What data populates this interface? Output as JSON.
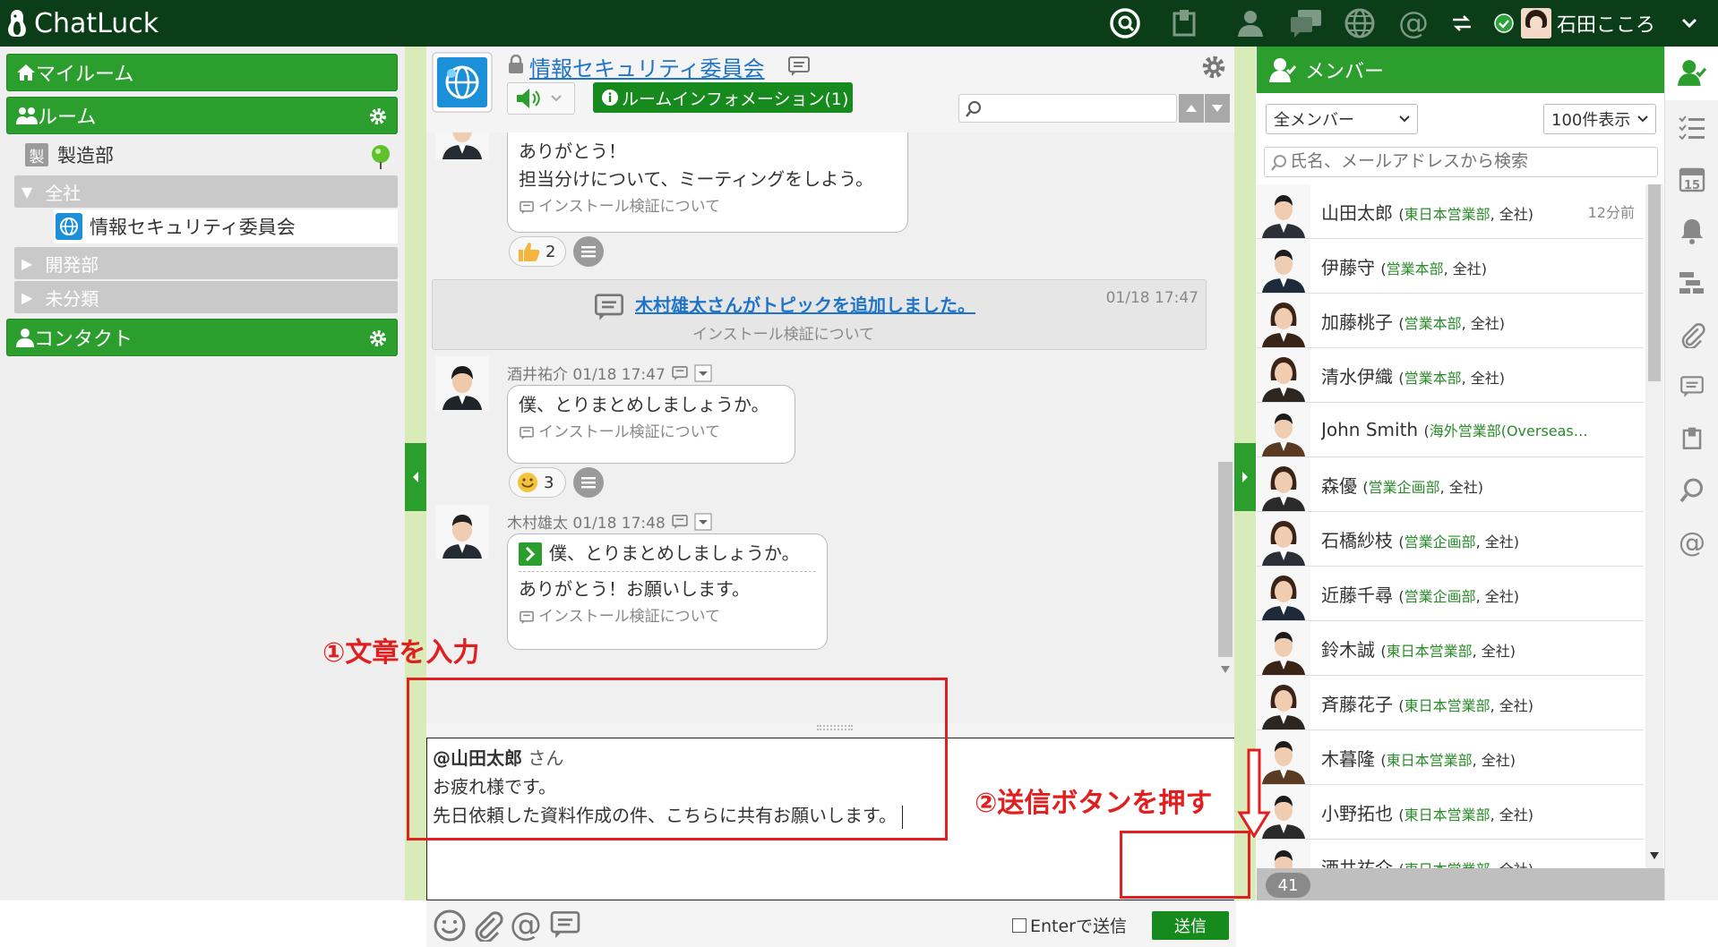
{
  "app": {
    "name": "ChatLuck"
  },
  "user": {
    "name": "石田こころ"
  },
  "sidebar": {
    "myroom": "マイルーム",
    "rooms": "ルーム",
    "seizo_icon": "製",
    "seizo": "製造部",
    "zensha": "全社",
    "room_active": "情報セキュリティ委員会",
    "kaihatsu": "開発部",
    "mibunrui": "未分類",
    "contacts": "コンタクト"
  },
  "room": {
    "title": "情報セキュリティ委員会",
    "info_button": "ルームインフォメーション(1)",
    "search_placeholder": ""
  },
  "messages": {
    "m1_line1": "ありがとう！",
    "m1_line2": "担当分けについて、ミーティングをしよう。",
    "topic": "インストール検証について",
    "reaction1_count": "2",
    "sys_title": "木村雄太さんがトピックを追加しました。",
    "sys_time": "01/18 17:47",
    "m2_meta": "酒井祐介 01/18 17:47",
    "m2_text": "僕、とりまとめしましょうか。",
    "reaction2_count": "3",
    "m3_meta": "木村雄太 01/18 17:48",
    "m3_quote": "僕、とりまとめしましょうか。",
    "m3_text": "ありがとう！お願いします。"
  },
  "composer": {
    "mention": "@山田太郎",
    "mention_suffix": "さん",
    "line2": "お疲れ様です。",
    "line3": "先日依頼した資料作成の件、こちらに共有お願いします。",
    "enter_label": "Enterで送信",
    "send": "送信"
  },
  "annotations": {
    "step1": "①文章を入力",
    "step2": "②送信ボタンを押す"
  },
  "members": {
    "title": "メンバー",
    "filter": "全メンバー",
    "page_size": "100件表示",
    "search_placeholder": "氏名、メールアドレスから検索",
    "count": "41",
    "list": [
      {
        "name": "山田太郎",
        "dept": "東日本営業部",
        "tail": ", 全社)",
        "time": "12分前"
      },
      {
        "name": "伊藤守",
        "dept": "営業本部",
        "tail": ", 全社)"
      },
      {
        "name": "加藤桃子",
        "dept": "営業本部",
        "tail": ", 全社)"
      },
      {
        "name": "清水伊織",
        "dept": "営業本部",
        "tail": ", 全社)"
      },
      {
        "name": "John Smith",
        "dept": "海外営業部(Overseas…",
        "tail": ""
      },
      {
        "name": "森優",
        "dept": "営業企画部",
        "tail": ", 全社)"
      },
      {
        "name": "石橋紗枝",
        "dept": "営業企画部",
        "tail": ", 全社)"
      },
      {
        "name": "近藤千尋",
        "dept": "営業企画部",
        "tail": ", 全社)"
      },
      {
        "name": "鈴木誠",
        "dept": "東日本営業部",
        "tail": ", 全社)"
      },
      {
        "name": "斉藤花子",
        "dept": "東日本営業部",
        "tail": ", 全社)"
      },
      {
        "name": "木暮隆",
        "dept": "東日本営業部",
        "tail": ", 全社)"
      },
      {
        "name": "小野拓也",
        "dept": "東日本営業部",
        "tail": ", 全社)"
      },
      {
        "name": "酒井祐介",
        "dept": "東日本営業部",
        "tail": ", 全社)"
      }
    ]
  },
  "colors": {
    "topbar": "#0a3d18",
    "green": "#2c9e2e",
    "red": "#e02020",
    "link": "#1f74c8"
  }
}
